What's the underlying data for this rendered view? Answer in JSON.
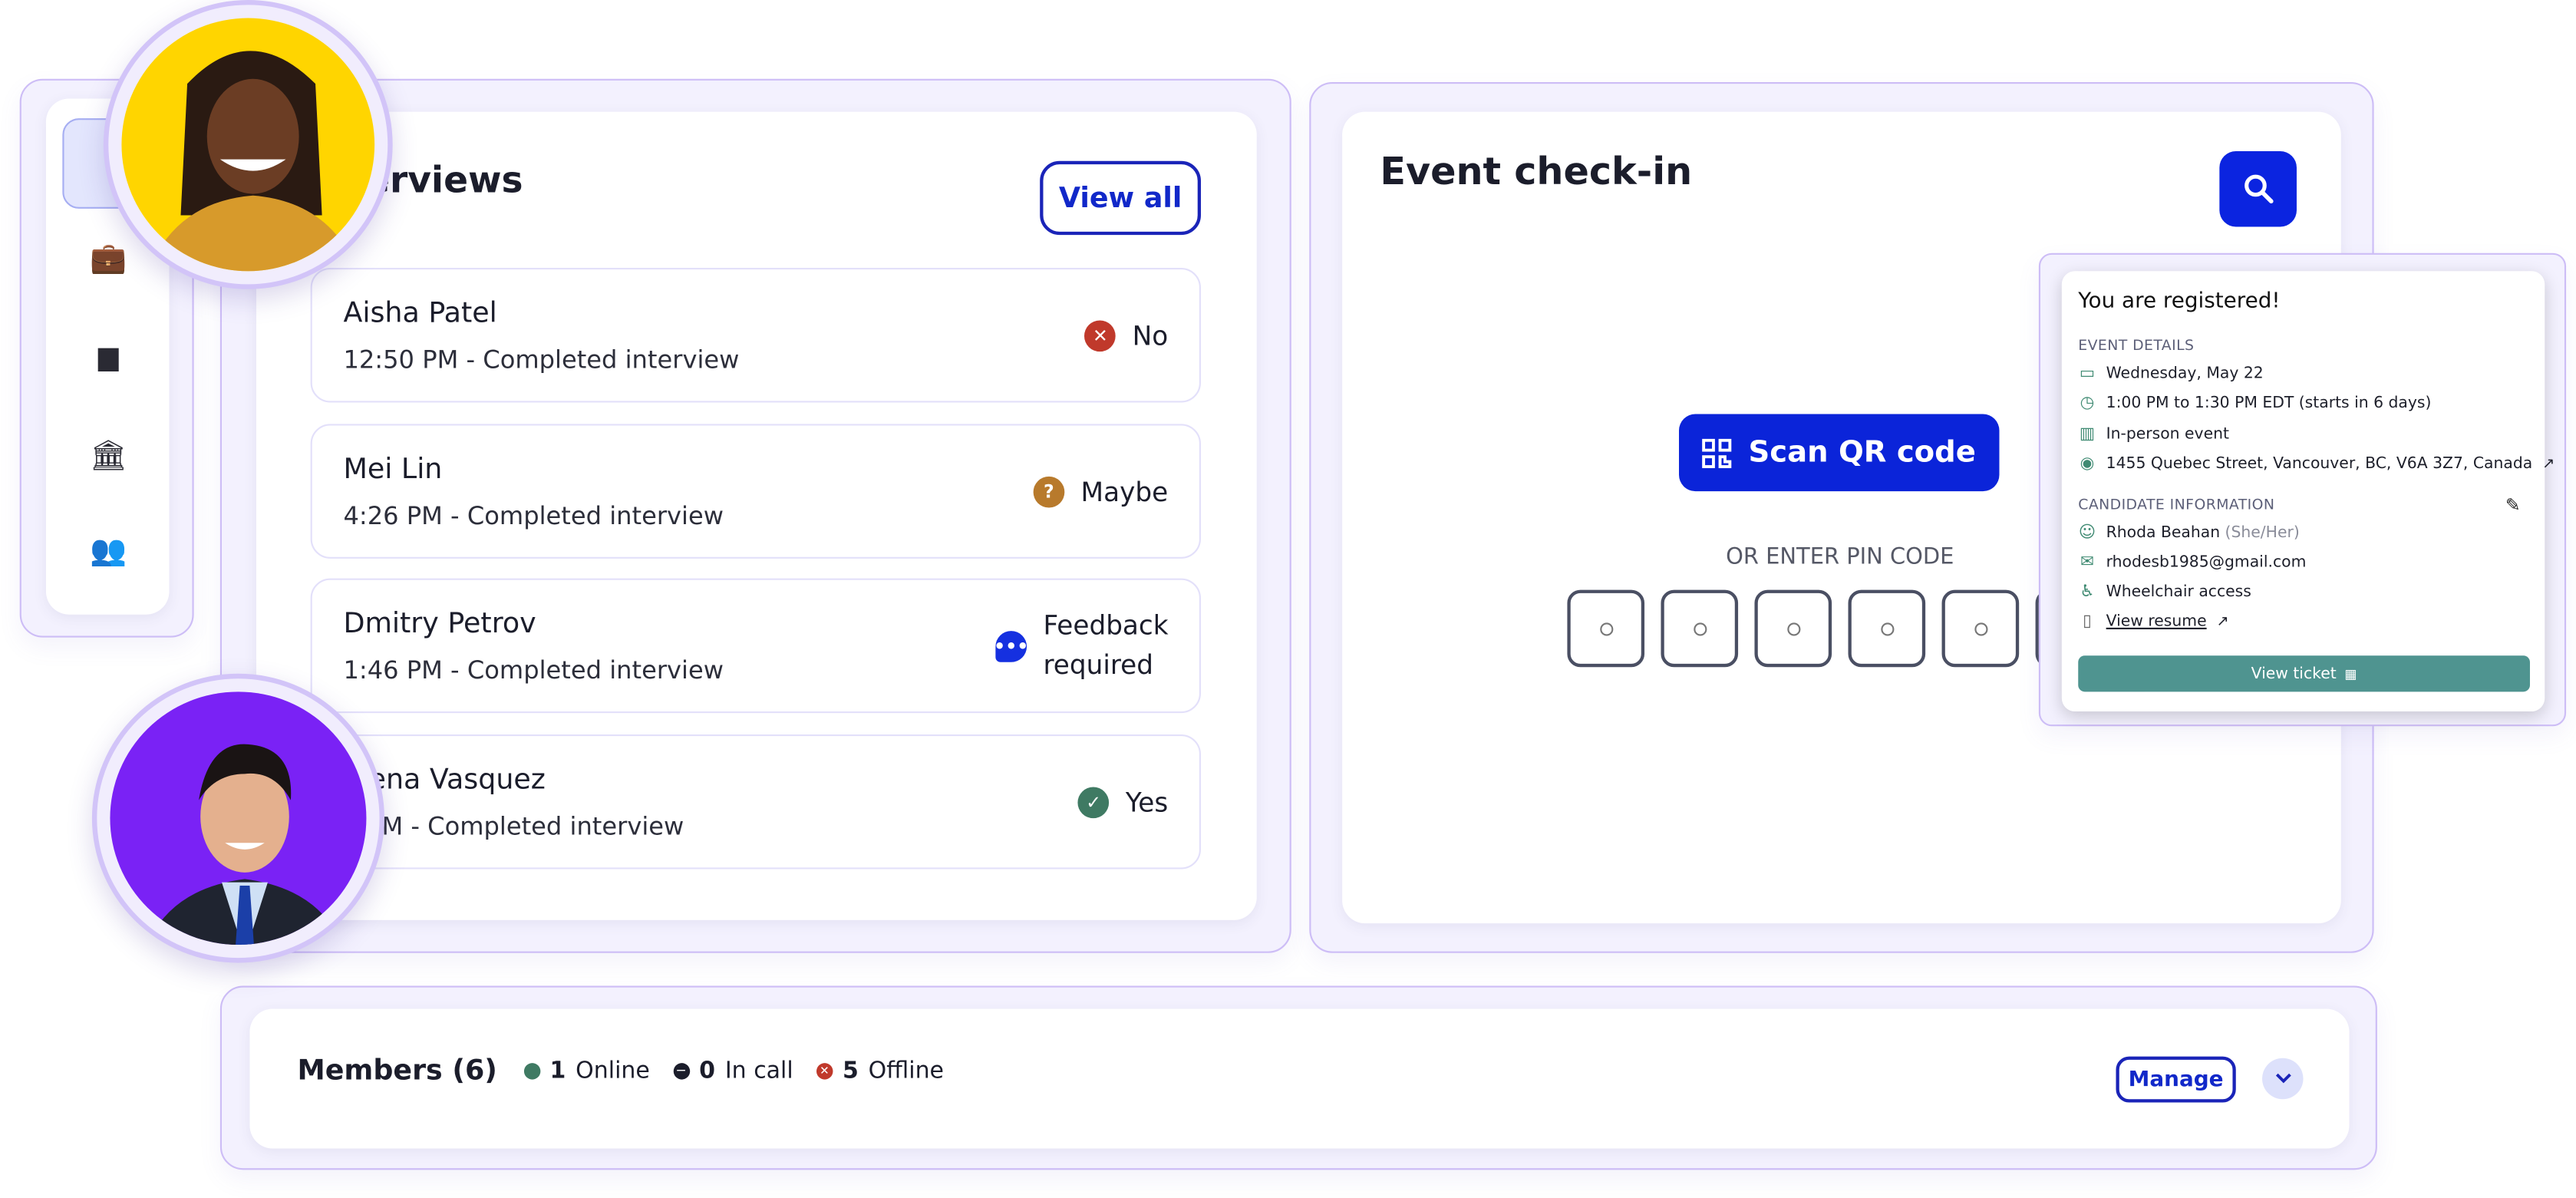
{
  "sidebar": {
    "items": [
      {
        "icon": "home-icon",
        "active": true
      },
      {
        "icon": "briefcase-icon"
      },
      {
        "icon": "calendar-icon"
      },
      {
        "icon": "institution-icon"
      },
      {
        "icon": "team-icon"
      }
    ]
  },
  "interviews": {
    "title": "Interviews",
    "view_all": "View all",
    "rows": [
      {
        "name": "Aisha Patel",
        "detail": "12:50 PM - Completed interview",
        "status": "No",
        "status_icon": "x-circle-icon",
        "status_color": "#c0392b"
      },
      {
        "name": "Mei Lin",
        "detail": "4:26 PM - Completed interview",
        "status": "Maybe",
        "status_icon": "question-circle-icon",
        "status_color": "#b87a2c"
      },
      {
        "name": "Dmitry Petrov",
        "detail": "1:46 PM - Completed interview",
        "status": "Feedback required",
        "status_icon": "chat-bubble-icon",
        "status_color": "#1530e0"
      },
      {
        "name": "Elena Vasquez",
        "detail": "3 PM - Completed interview",
        "status": "Yes",
        "status_icon": "check-circle-icon",
        "status_color": "#3f7a63"
      }
    ]
  },
  "checkin": {
    "title": "Event check-in",
    "scan_label": "Scan QR code",
    "pin_label": "OR ENTER PIN CODE",
    "pin_digits": 6,
    "accent": "#0b24d9"
  },
  "registration": {
    "title": "You are registered!",
    "event_heading": "EVENT DETAILS",
    "date": "Wednesday, May 22",
    "time": "1:00 PM to 1:30 PM EDT (starts in 6 days)",
    "type": "In-person event",
    "address": "1455 Quebec Street, Vancouver, BC, V6A 3Z7, Canada",
    "candidate_heading": "CANDIDATE INFORMATION",
    "name": "Rhoda Beahan",
    "pronouns": "(She/Her)",
    "email": "rhodesb1985@gmail.com",
    "accessibility": "Wheelchair access",
    "resume_link": "View resume",
    "ticket_button": "View ticket",
    "button_color": "#4f9490"
  },
  "members": {
    "title": "Members (6)",
    "online_count": "1",
    "online_label": "Online",
    "incall_count": "0",
    "incall_label": "In call",
    "offline_count": "5",
    "offline_label": "Offline",
    "manage": "Manage"
  }
}
